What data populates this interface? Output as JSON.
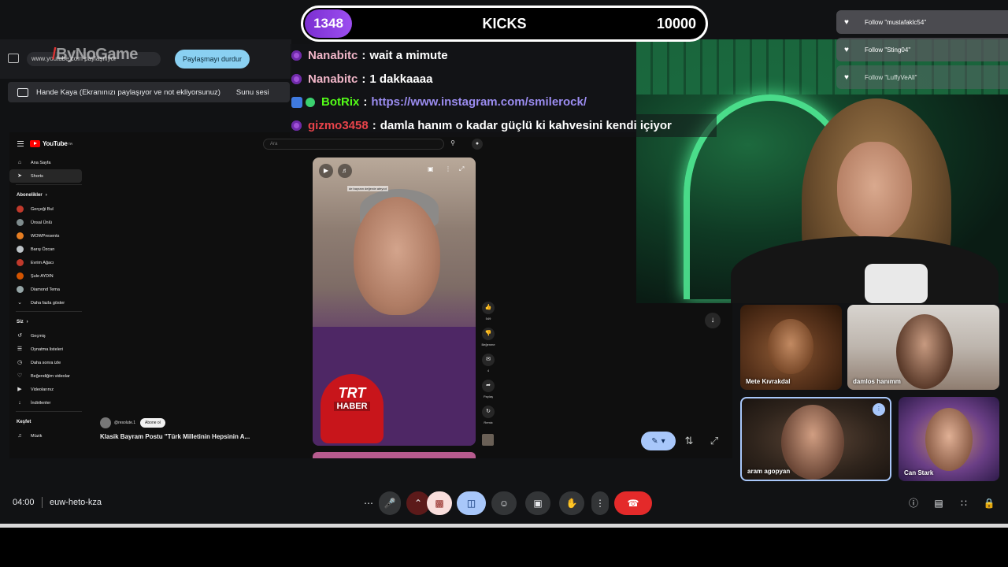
{
  "overlay": {
    "kicks_count": "1348",
    "kicks_label": "KICKS",
    "kicks_goal": "10000",
    "chat": [
      {
        "user": "Nanabitc",
        "sep": ":",
        "message": "wait a mimute"
      },
      {
        "user": "Nanabitc",
        "sep": ":",
        "message": "1 dakkaaaa"
      },
      {
        "user": "BotRix",
        "sep": ":",
        "message": "https://www.instagram.com/smilerock/"
      },
      {
        "user": "gizmo3458",
        "sep": ":",
        "message": "damla hanım o kadar güçlü ki kahvesini kendi içiyor"
      }
    ],
    "follows": [
      "Follow \"mustafaklc54\"",
      "Follow \"Sting04\"",
      "Follow \"LuffyVeAll\""
    ],
    "watermark": "ByNoGame"
  },
  "share": {
    "url": "www.youtube.com paylaşılıyor",
    "stop_button": "Paylaşmayı durdur",
    "presenting_text": "Hande Kaya (Ekranınızı paylaşıyor ve not ekliyorsunuz)",
    "audio_label": "Sunu sesi"
  },
  "youtube": {
    "logo": "YouTube",
    "logo_sup": "TR",
    "search_placeholder": "Ara",
    "nav": [
      {
        "label": "Ana Sayfa",
        "icon": "home-icon"
      },
      {
        "label": "Shorts",
        "icon": "shorts-icon"
      }
    ],
    "subs_header": "Abonelikler",
    "subs": [
      {
        "label": "Gerçeği Bul",
        "color": "#c0392b"
      },
      {
        "label": "Ünsal Ünlü",
        "color": "#7f8c8d"
      },
      {
        "label": "WOWPresents",
        "color": "#e67e22"
      },
      {
        "label": "Barış Özcan",
        "color": "#bdc3c7"
      },
      {
        "label": "Evrim Ağacı",
        "color": "#c0392b"
      },
      {
        "label": "Şule AYDIN",
        "color": "#d35400"
      },
      {
        "label": "Diamond Tema",
        "color": "#95a5a6"
      }
    ],
    "show_more": "Daha fazla göster",
    "you_header": "Siz",
    "you_items": [
      {
        "label": "Geçmiş",
        "icon": "history-icon"
      },
      {
        "label": "Oynatma listeleri",
        "icon": "playlist-icon"
      },
      {
        "label": "Daha sonra izle",
        "icon": "watch-later-icon"
      },
      {
        "label": "Beğendiğim videolar",
        "icon": "like-icon"
      },
      {
        "label": "Videolarınız",
        "icon": "your-videos-icon"
      },
      {
        "label": "İndirilenler",
        "icon": "download-icon"
      }
    ],
    "explore_header": "Keşfet",
    "explore_items": [
      {
        "label": "Müzik",
        "icon": "music-icon"
      }
    ],
    "video": {
      "caption": "de bayram değerde ateyıot",
      "mic_line1": "TRT",
      "mic_line2": "HABER"
    },
    "actions": [
      {
        "icon": "like-icon",
        "label": "549"
      },
      {
        "icon": "dislike-icon",
        "label": "Beğenme"
      },
      {
        "icon": "comment-icon",
        "label": "4"
      },
      {
        "icon": "share-icon",
        "label": "Paylaş"
      },
      {
        "icon": "remix-icon",
        "label": "Remix"
      }
    ],
    "channel": "@resolute.1",
    "subscribe": "Abone ol",
    "title": "Klasik Bayram Postu \"Türk Milletinin Hepsinin A..."
  },
  "participants": [
    {
      "name": "Mete Kıvrakdal"
    },
    {
      "name": "damlos hanımm"
    },
    {
      "name": "aram agopyan"
    },
    {
      "name": "Can Stark"
    }
  ],
  "call": {
    "time": "04:00",
    "code": "euw-heto-kza"
  },
  "colors": {
    "kicks_purple": "#7b2fd1",
    "kick_green": "#53fc18",
    "meet_blue": "#a8c7fa",
    "end_call_red": "#e42a2a"
  }
}
